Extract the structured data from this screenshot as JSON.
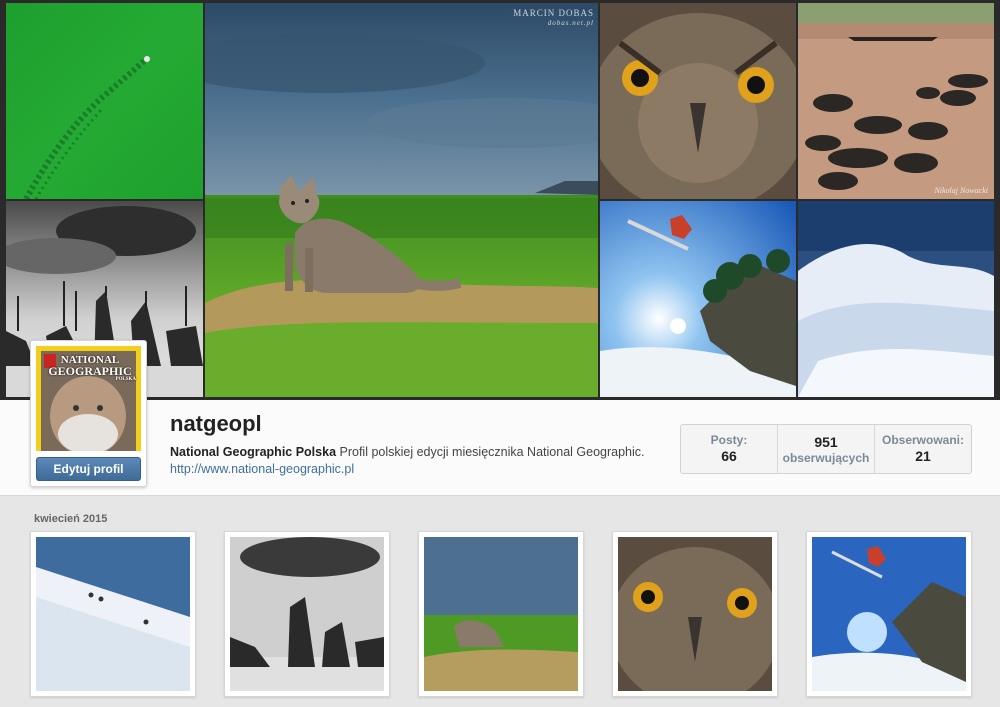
{
  "profile": {
    "username": "natgeopl",
    "full_name": "National Geographic Polska",
    "bio": " Profil polskiej edycji miesięcznika National Geographic.",
    "website": "http://www.national-geographic.pl",
    "edit_button": "Edytuj profil",
    "cover_title_1": "NATIONAL",
    "cover_title_2": "GEOGRAPHIC",
    "cover_sub": "POLSKA"
  },
  "stats": [
    {
      "label": "Posty:",
      "value": "66"
    },
    {
      "label": "obserwujących",
      "value": "951"
    },
    {
      "label": "Obserwowani:",
      "value": "21"
    }
  ],
  "watermarks": {
    "fox_author": "MARCIN DOBAS",
    "fox_site": "dobas.net.pl",
    "buffalo_author": "Nikolaj Nowacki"
  },
  "feed": {
    "month_label": "kwiecień 2015"
  },
  "colors": {
    "link": "#3f6fa0",
    "button": "#4a76a6"
  }
}
